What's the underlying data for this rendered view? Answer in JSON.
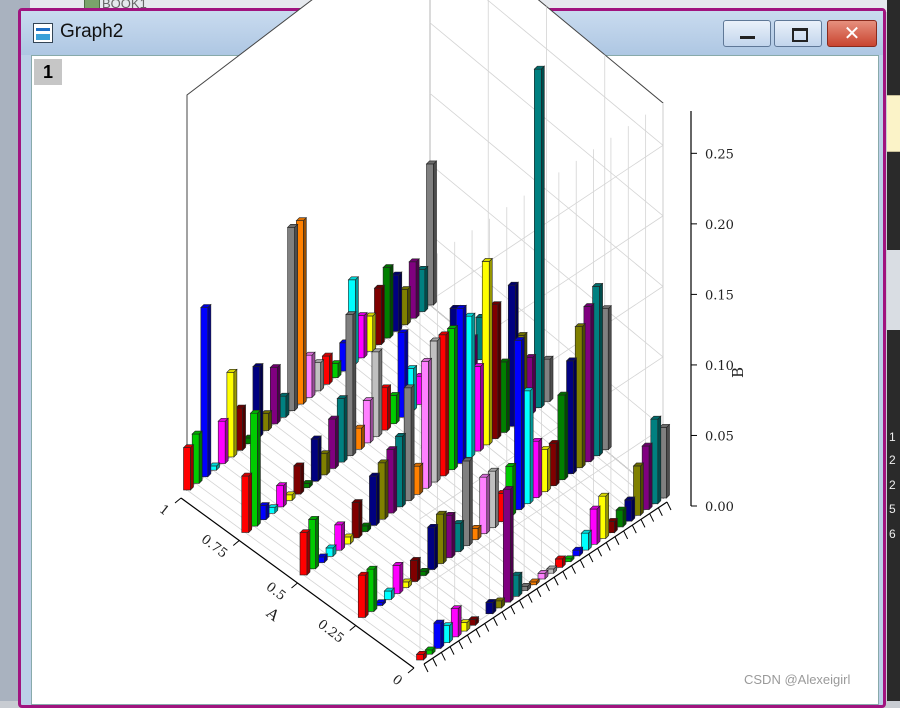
{
  "background": {
    "top_label": "BOOK1",
    "right_numbers": [
      "1",
      "2",
      "2",
      "5",
      "6"
    ]
  },
  "window": {
    "title": "Graph2",
    "layer_label": "1",
    "buttons": {
      "minimize": "minimize-icon",
      "maximize": "maximize-icon",
      "close": "close-icon"
    },
    "close_glyph": "✕",
    "frame_color": "#a0147f"
  },
  "watermark": "CSDN @Alexeigirl",
  "chart_data": {
    "type": "bar",
    "subtype": "3d-bar",
    "title": "",
    "xlabel": "A",
    "ylabel": "",
    "zlabel": "B",
    "x_ticks": [
      "0",
      "0.25",
      "0.5",
      "0.75",
      "1"
    ],
    "y_tick_labels_note": "category labels too small to read",
    "z_ticks": [
      "0.00",
      "0.05",
      "0.10",
      "0.15",
      "0.20",
      "0.25"
    ],
    "zlim": [
      0,
      0.28
    ],
    "grid": true,
    "colors": [
      "#ff0000",
      "#00cc00",
      "#0000ff",
      "#00ffff",
      "#ff00ff",
      "#ffff00",
      "#800000",
      "#008000",
      "#000080",
      "#808000",
      "#800080",
      "#008080",
      "#808080",
      "#ff8000",
      "#ff80ff",
      "#c0c0c0"
    ],
    "bars": [
      {
        "x": 0.0,
        "y": 0,
        "z": 0.004
      },
      {
        "x": 0.0,
        "y": 1,
        "z": 0.003
      },
      {
        "x": 0.0,
        "y": 2,
        "z": 0.018
      },
      {
        "x": 0.0,
        "y": 3,
        "z": 0.012
      },
      {
        "x": 0.0,
        "y": 4,
        "z": 0.02
      },
      {
        "x": 0.0,
        "y": 5,
        "z": 0.006
      },
      {
        "x": 0.0,
        "y": 6,
        "z": 0.004
      },
      {
        "x": 0.0,
        "y": 8,
        "z": 0.008
      },
      {
        "x": 0.0,
        "y": 9,
        "z": 0.005
      },
      {
        "x": 0.0,
        "y": 10,
        "z": 0.08
      },
      {
        "x": 0.0,
        "y": 11,
        "z": 0.015
      },
      {
        "x": 0.0,
        "y": 12,
        "z": 0.003
      },
      {
        "x": 0.0,
        "y": 13,
        "z": 0.002
      },
      {
        "x": 0.0,
        "y": 14,
        "z": 0.004
      },
      {
        "x": 0.0,
        "y": 15,
        "z": 0.003
      },
      {
        "x": 0.0,
        "y": 16,
        "z": 0.006
      },
      {
        "x": 0.0,
        "y": 17,
        "z": 0.002
      },
      {
        "x": 0.0,
        "y": 18,
        "z": 0.004
      },
      {
        "x": 0.0,
        "y": 19,
        "z": 0.012
      },
      {
        "x": 0.0,
        "y": 20,
        "z": 0.025
      },
      {
        "x": 0.0,
        "y": 21,
        "z": 0.03
      },
      {
        "x": 0.0,
        "y": 22,
        "z": 0.008
      },
      {
        "x": 0.0,
        "y": 23,
        "z": 0.012
      },
      {
        "x": 0.0,
        "y": 24,
        "z": 0.015
      },
      {
        "x": 0.0,
        "y": 25,
        "z": 0.035
      },
      {
        "x": 0.0,
        "y": 26,
        "z": 0.045
      },
      {
        "x": 0.0,
        "y": 27,
        "z": 0.06
      },
      {
        "x": 0.0,
        "y": 28,
        "z": 0.05
      },
      {
        "x": 0.25,
        "y": 0,
        "z": 0.03
      },
      {
        "x": 0.25,
        "y": 1,
        "z": 0.03
      },
      {
        "x": 0.25,
        "y": 2,
        "z": 0.002
      },
      {
        "x": 0.25,
        "y": 3,
        "z": 0.006
      },
      {
        "x": 0.25,
        "y": 4,
        "z": 0.02
      },
      {
        "x": 0.25,
        "y": 5,
        "z": 0.004
      },
      {
        "x": 0.25,
        "y": 6,
        "z": 0.015
      },
      {
        "x": 0.25,
        "y": 7,
        "z": 0.003
      },
      {
        "x": 0.25,
        "y": 8,
        "z": 0.03
      },
      {
        "x": 0.25,
        "y": 9,
        "z": 0.035
      },
      {
        "x": 0.25,
        "y": 10,
        "z": 0.03
      },
      {
        "x": 0.25,
        "y": 11,
        "z": 0.02
      },
      {
        "x": 0.25,
        "y": 12,
        "z": 0.06
      },
      {
        "x": 0.25,
        "y": 13,
        "z": 0.008
      },
      {
        "x": 0.25,
        "y": 14,
        "z": 0.04
      },
      {
        "x": 0.25,
        "y": 15,
        "z": 0.04
      },
      {
        "x": 0.25,
        "y": 16,
        "z": 0.02
      },
      {
        "x": 0.25,
        "y": 17,
        "z": 0.035
      },
      {
        "x": 0.25,
        "y": 18,
        "z": 0.12
      },
      {
        "x": 0.25,
        "y": 19,
        "z": 0.08
      },
      {
        "x": 0.25,
        "y": 20,
        "z": 0.04
      },
      {
        "x": 0.25,
        "y": 21,
        "z": 0.03
      },
      {
        "x": 0.25,
        "y": 22,
        "z": 0.03
      },
      {
        "x": 0.25,
        "y": 23,
        "z": 0.06
      },
      {
        "x": 0.25,
        "y": 24,
        "z": 0.08
      },
      {
        "x": 0.25,
        "y": 25,
        "z": 0.1
      },
      {
        "x": 0.25,
        "y": 26,
        "z": 0.11
      },
      {
        "x": 0.25,
        "y": 27,
        "z": 0.12
      },
      {
        "x": 0.25,
        "y": 28,
        "z": 0.1
      },
      {
        "x": 0.5,
        "y": 0,
        "z": 0.03
      },
      {
        "x": 0.5,
        "y": 1,
        "z": 0.035
      },
      {
        "x": 0.5,
        "y": 2,
        "z": 0.004
      },
      {
        "x": 0.5,
        "y": 3,
        "z": 0.006
      },
      {
        "x": 0.5,
        "y": 4,
        "z": 0.018
      },
      {
        "x": 0.5,
        "y": 5,
        "z": 0.005
      },
      {
        "x": 0.5,
        "y": 6,
        "z": 0.025
      },
      {
        "x": 0.5,
        "y": 7,
        "z": 0.004
      },
      {
        "x": 0.5,
        "y": 8,
        "z": 0.035
      },
      {
        "x": 0.5,
        "y": 9,
        "z": 0.04
      },
      {
        "x": 0.5,
        "y": 10,
        "z": 0.045
      },
      {
        "x": 0.5,
        "y": 11,
        "z": 0.05
      },
      {
        "x": 0.5,
        "y": 12,
        "z": 0.08
      },
      {
        "x": 0.5,
        "y": 13,
        "z": 0.02
      },
      {
        "x": 0.5,
        "y": 14,
        "z": 0.09
      },
      {
        "x": 0.5,
        "y": 15,
        "z": 0.1
      },
      {
        "x": 0.5,
        "y": 16,
        "z": 0.1
      },
      {
        "x": 0.5,
        "y": 17,
        "z": 0.1
      },
      {
        "x": 0.5,
        "y": 18,
        "z": 0.11
      },
      {
        "x": 0.5,
        "y": 19,
        "z": 0.1
      },
      {
        "x": 0.5,
        "y": 20,
        "z": 0.06
      },
      {
        "x": 0.5,
        "y": 21,
        "z": 0.13
      },
      {
        "x": 0.5,
        "y": 22,
        "z": 0.095
      },
      {
        "x": 0.5,
        "y": 23,
        "z": 0.05
      },
      {
        "x": 0.5,
        "y": 24,
        "z": 0.1
      },
      {
        "x": 0.5,
        "y": 25,
        "z": 0.06
      },
      {
        "x": 0.5,
        "y": 26,
        "z": 0.04
      },
      {
        "x": 0.5,
        "y": 27,
        "z": 0.24
      },
      {
        "x": 0.5,
        "y": 28,
        "z": 0.03
      },
      {
        "x": 0.75,
        "y": 0,
        "z": 0.04
      },
      {
        "x": 0.75,
        "y": 1,
        "z": 0.08
      },
      {
        "x": 0.75,
        "y": 2,
        "z": 0.01
      },
      {
        "x": 0.75,
        "y": 3,
        "z": 0.004
      },
      {
        "x": 0.75,
        "y": 4,
        "z": 0.015
      },
      {
        "x": 0.75,
        "y": 5,
        "z": 0.004
      },
      {
        "x": 0.75,
        "y": 6,
        "z": 0.02
      },
      {
        "x": 0.75,
        "y": 7,
        "z": 0.003
      },
      {
        "x": 0.75,
        "y": 8,
        "z": 0.03
      },
      {
        "x": 0.75,
        "y": 9,
        "z": 0.015
      },
      {
        "x": 0.75,
        "y": 10,
        "z": 0.035
      },
      {
        "x": 0.75,
        "y": 11,
        "z": 0.045
      },
      {
        "x": 0.75,
        "y": 12,
        "z": 0.1
      },
      {
        "x": 0.75,
        "y": 13,
        "z": 0.015
      },
      {
        "x": 0.75,
        "y": 14,
        "z": 0.03
      },
      {
        "x": 0.75,
        "y": 15,
        "z": 0.06
      },
      {
        "x": 0.75,
        "y": 16,
        "z": 0.03
      },
      {
        "x": 0.75,
        "y": 17,
        "z": 0.02
      },
      {
        "x": 0.75,
        "y": 18,
        "z": 0.06
      },
      {
        "x": 0.75,
        "y": 19,
        "z": 0.03
      },
      {
        "x": 0.75,
        "y": 20,
        "z": 0.02
      },
      {
        "x": 0.75,
        "y": 21,
        "z": 0.02
      },
      {
        "x": 0.75,
        "y": 22,
        "z": 0.015
      },
      {
        "x": 0.75,
        "y": 23,
        "z": 0.03
      },
      {
        "x": 0.75,
        "y": 24,
        "z": 0.05
      },
      {
        "x": 0.75,
        "y": 25,
        "z": 0.03
      },
      {
        "x": 0.75,
        "y": 26,
        "z": 0.02
      },
      {
        "x": 0.75,
        "y": 27,
        "z": 0.03
      },
      {
        "x": 0.75,
        "y": 28,
        "z": 0.02
      },
      {
        "x": 1.0,
        "y": 0,
        "z": 0.03
      },
      {
        "x": 1.0,
        "y": 1,
        "z": 0.035
      },
      {
        "x": 1.0,
        "y": 2,
        "z": 0.12
      },
      {
        "x": 1.0,
        "y": 3,
        "z": 0.003
      },
      {
        "x": 1.0,
        "y": 4,
        "z": 0.03
      },
      {
        "x": 1.0,
        "y": 5,
        "z": 0.06
      },
      {
        "x": 1.0,
        "y": 6,
        "z": 0.03
      },
      {
        "x": 1.0,
        "y": 7,
        "z": 0.004
      },
      {
        "x": 1.0,
        "y": 8,
        "z": 0.05
      },
      {
        "x": 1.0,
        "y": 9,
        "z": 0.012
      },
      {
        "x": 1.0,
        "y": 10,
        "z": 0.04
      },
      {
        "x": 1.0,
        "y": 11,
        "z": 0.015
      },
      {
        "x": 1.0,
        "y": 12,
        "z": 0.13
      },
      {
        "x": 1.0,
        "y": 13,
        "z": 0.13
      },
      {
        "x": 1.0,
        "y": 14,
        "z": 0.03
      },
      {
        "x": 1.0,
        "y": 15,
        "z": 0.02
      },
      {
        "x": 1.0,
        "y": 16,
        "z": 0.02
      },
      {
        "x": 1.0,
        "y": 17,
        "z": 0.01
      },
      {
        "x": 1.0,
        "y": 18,
        "z": 0.02
      },
      {
        "x": 1.0,
        "y": 19,
        "z": 0.06
      },
      {
        "x": 1.0,
        "y": 20,
        "z": 0.03
      },
      {
        "x": 1.0,
        "y": 21,
        "z": 0.025
      },
      {
        "x": 1.0,
        "y": 22,
        "z": 0.04
      },
      {
        "x": 1.0,
        "y": 23,
        "z": 0.05
      },
      {
        "x": 1.0,
        "y": 24,
        "z": 0.04
      },
      {
        "x": 1.0,
        "y": 25,
        "z": 0.025
      },
      {
        "x": 1.0,
        "y": 26,
        "z": 0.04
      },
      {
        "x": 1.0,
        "y": 27,
        "z": 0.03
      },
      {
        "x": 1.0,
        "y": 28,
        "z": 0.1
      }
    ]
  }
}
